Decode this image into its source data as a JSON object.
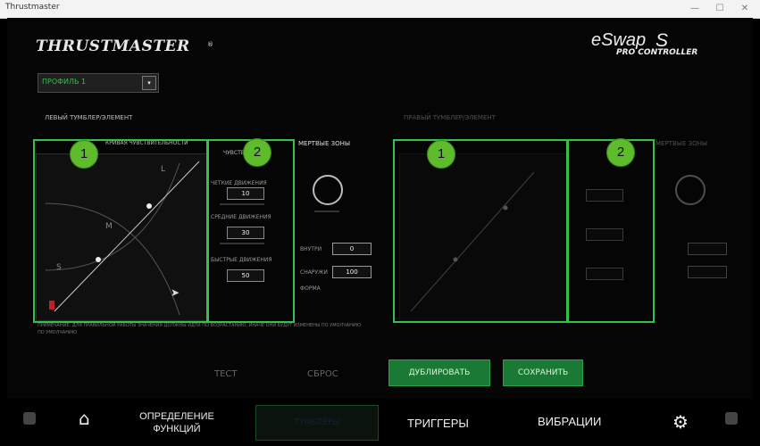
{
  "window": {
    "title": "Thrustmaster",
    "minimize": "—",
    "maximize": "☐",
    "close": "✕"
  },
  "brand": {
    "logo_text": "THRUSTMASTER",
    "trademark": "®",
    "product_e": "eSwap",
    "product_s": "S",
    "product_sub": "PRO CONTROLLER"
  },
  "profile": {
    "value": "ПРОФИЛЬ 1",
    "dropdown_glyph": "▾"
  },
  "left_stick": {
    "section_title": "ЛЕВЫЙ ТУМБЛЕР/ЭЛЕМЕНТ",
    "curve_title": "КРИВАЯ ЧУВСТВИТЕЛЬНОСТИ",
    "curve_sub": "ЧУВСТВ.",
    "axis_labels": {
      "l": "L",
      "m": "M",
      "s": "S"
    },
    "zone_labels": [
      "ЧЕТКИЕ ДВИЖЕНИЯ",
      "СРЕДНИЕ ДВИЖЕНИЯ",
      "БЫСТРЫЕ ДВИЖЕНИЯ"
    ],
    "zone_values": [
      "10",
      "30",
      "50"
    ],
    "deadzone_title": "МЕРТВЫЕ ЗОНЫ",
    "dz_labels": [
      "ВНУТРИ",
      "СНАРУЖИ",
      "ФОРМА"
    ],
    "dz_values": [
      "0",
      "100"
    ]
  },
  "right_stick": {
    "section_title": "ПРАВЫЙ ТУМБЛЕР/ЭЛЕМЕНТ",
    "deadzone_title": "МЕРТВЫЕ ЗОНЫ"
  },
  "badges": [
    "1",
    "2",
    "1",
    "2"
  ],
  "footer_note": "ПРИМЕЧАНИЕ: ДЛЯ ПРАВИЛЬНОЙ РАБОТЫ ЗНАЧЕНИЯ ДОЛЖНЫ ИДТИ ПО ВОЗРАСТАНИЮ, ИНАЧЕ ОНИ БУДУТ ИЗМЕНЕНЫ ПО УМОЛЧАНИЮ",
  "footer_note2": "ПО УМОЛЧАНИЮ",
  "actions": {
    "test": "ТЕСТ",
    "reset": "СБРОС",
    "duplicate": "ДУБЛИРОВАТЬ",
    "save": "СОХРАНИТЬ"
  },
  "nav": {
    "functions_line1": "ОПРЕДЕЛЕНИЕ",
    "functions_line2": "ФУНКЦИЙ",
    "sticks": "ТУМБЛЕРЫ",
    "triggers": "ТРИГГЕРЫ",
    "vibrations": "ВИБРАЦИИ"
  },
  "colors": {
    "highlight": "#31c24a",
    "badge": "#5dbb2c",
    "button_green": "#1a7a35"
  }
}
